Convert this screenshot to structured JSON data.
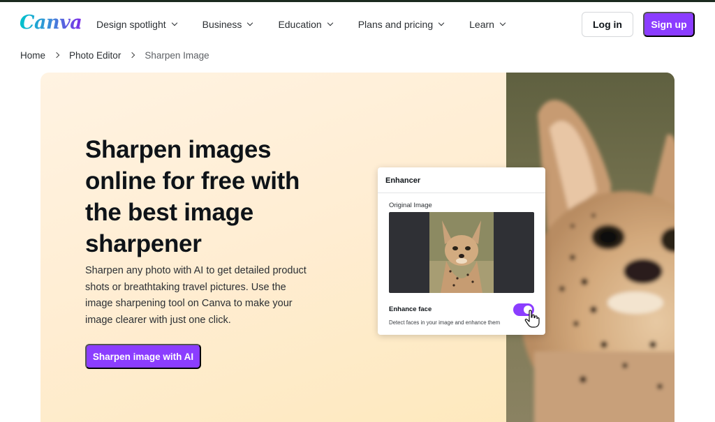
{
  "brand": {
    "logo_text": "Canva",
    "accent": "#8b3dff"
  },
  "nav": {
    "items": [
      {
        "label": "Design spotlight"
      },
      {
        "label": "Business"
      },
      {
        "label": "Education"
      },
      {
        "label": "Plans and pricing"
      },
      {
        "label": "Learn"
      }
    ],
    "login_label": "Log in",
    "signup_label": "Sign up"
  },
  "breadcrumb": {
    "items": [
      "Home",
      "Photo Editor",
      "Sharpen Image"
    ]
  },
  "hero": {
    "title": "Sharpen images online for free with the best image sharpener",
    "description": "Sharpen any photo with AI to get detailed product shots or breathtaking travel pictures. Use the image sharpening tool on Canva to make your image clearer with just one click.",
    "cta_label": "Sharpen image with AI"
  },
  "enhancer_card": {
    "title": "Enhancer",
    "original_label": "Original Image",
    "enhance_face_label": "Enhance face",
    "enhance_face_desc": "Detect faces in your image and enhance them",
    "enhance_face_on": true
  }
}
